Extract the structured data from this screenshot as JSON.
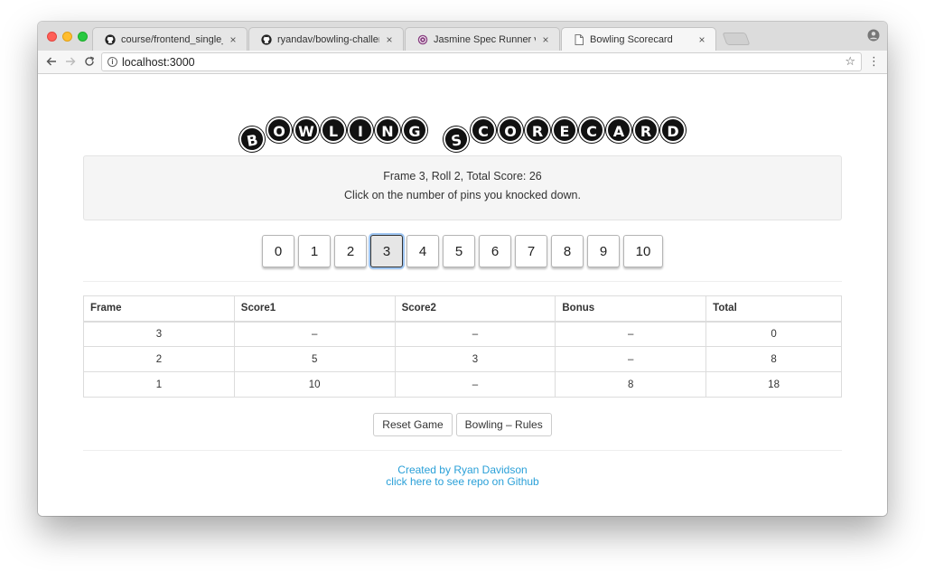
{
  "browser": {
    "tabs": [
      {
        "label": "course/frontend_single_page_a",
        "icon": "github-icon",
        "active": false
      },
      {
        "label": "ryandav/bowling-challenge: Cr",
        "icon": "github-icon",
        "active": false
      },
      {
        "label": "Jasmine Spec Runner v2.7.0",
        "icon": "jasmine-icon",
        "active": false
      },
      {
        "label": "Bowling Scorecard",
        "icon": "page-icon",
        "active": true
      }
    ],
    "close_glyph": "×",
    "url": "localhost:3000"
  },
  "page": {
    "title_words": [
      "BOWLING",
      "SCORECARD"
    ],
    "status": {
      "line1": "Frame 3, Roll 2, Total Score: 26",
      "line2": "Click on the number of pins you knocked down."
    },
    "pins": [
      "0",
      "1",
      "2",
      "3",
      "4",
      "5",
      "6",
      "7",
      "8",
      "9",
      "10"
    ],
    "selected_pin": "3",
    "table": {
      "headers": [
        "Frame",
        "Score1",
        "Score2",
        "Bonus",
        "Total"
      ],
      "rows": [
        [
          "3",
          "–",
          "–",
          "–",
          "0"
        ],
        [
          "2",
          "5",
          "3",
          "–",
          "8"
        ],
        [
          "1",
          "10",
          "–",
          "8",
          "18"
        ]
      ]
    },
    "buttons": {
      "reset": "Reset Game",
      "rules": "Bowling – Rules"
    },
    "footer": {
      "credit": "Created by Ryan Davidson",
      "repo_link": "click here to see repo on Github"
    },
    "link_color": "#2aa0d8"
  }
}
